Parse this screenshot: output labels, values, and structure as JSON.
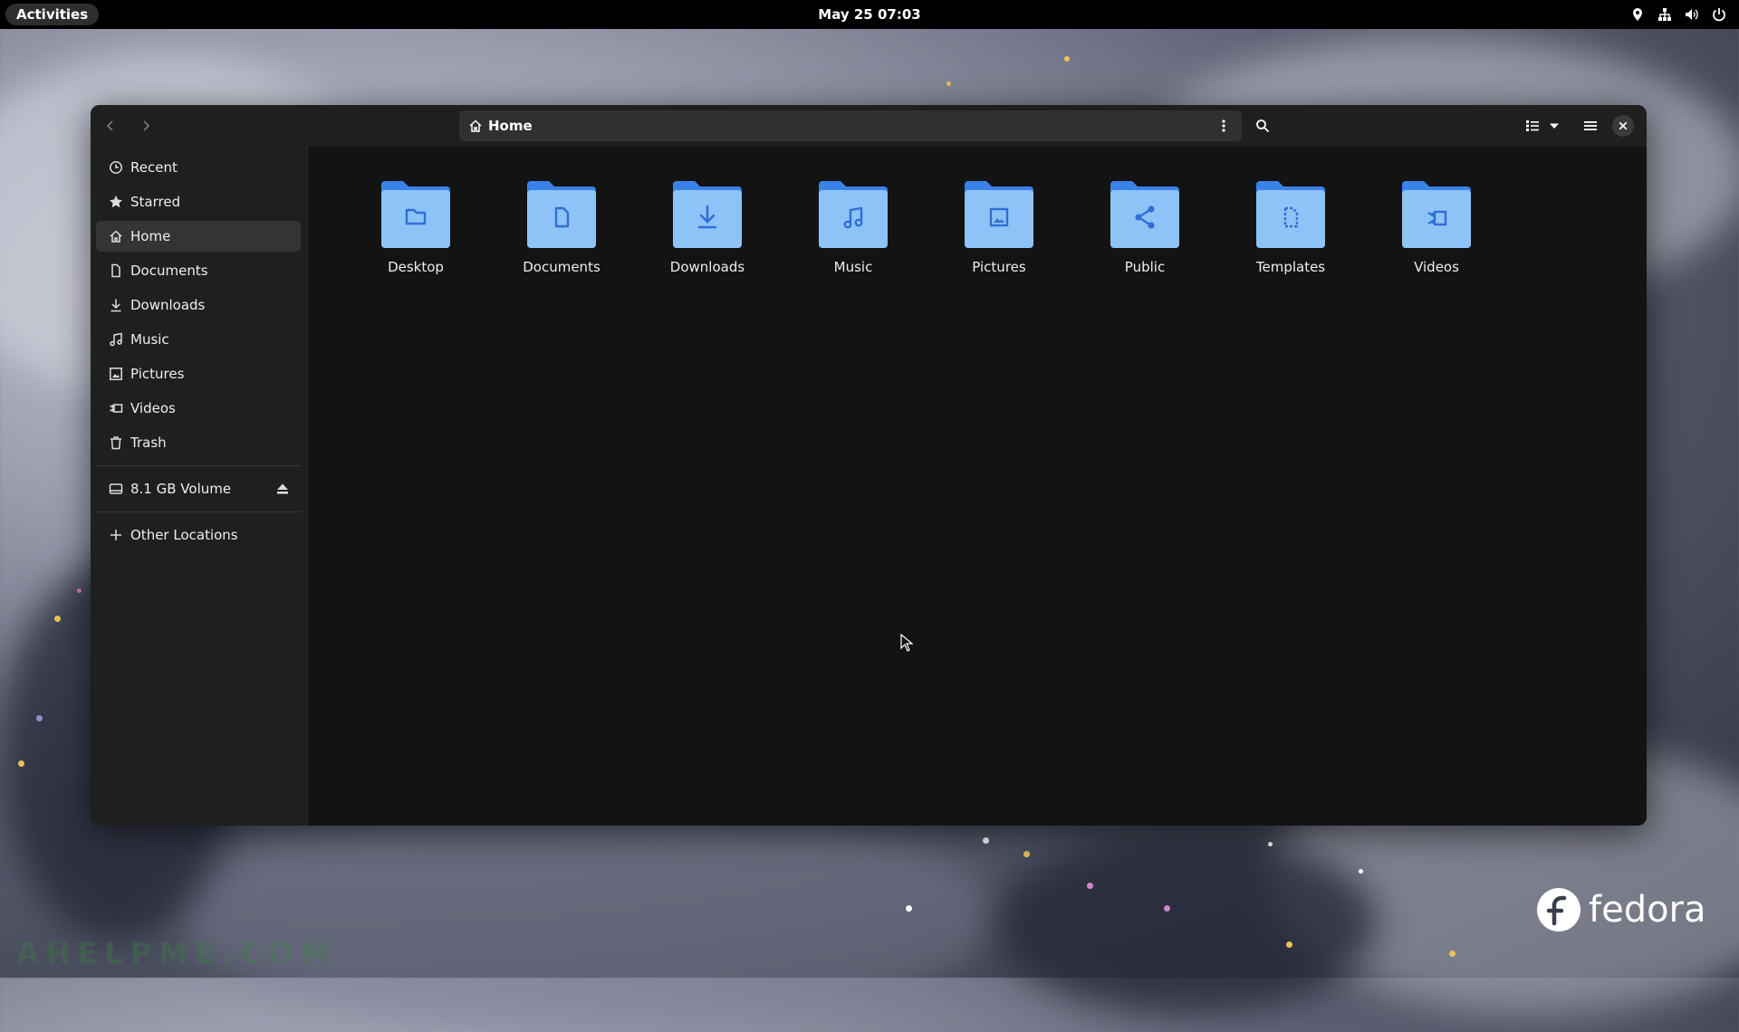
{
  "topbar": {
    "activities_label": "Activities",
    "clock": "May 25  07:03",
    "tray_icons": [
      "location-icon",
      "network-icon",
      "volume-icon",
      "power-icon"
    ]
  },
  "window": {
    "path_label": "Home",
    "nav_icons": [
      "back-icon",
      "forward-icon"
    ],
    "header_icons": [
      "path-menu-icon",
      "search-icon",
      "list-view-icon",
      "view-options-icon",
      "main-menu-icon",
      "close-icon"
    ]
  },
  "sidebar": {
    "items": [
      {
        "label": "Recent",
        "icon": "clock-icon"
      },
      {
        "label": "Starred",
        "icon": "star-icon"
      },
      {
        "label": "Home",
        "icon": "home-icon",
        "active": true
      },
      {
        "label": "Documents",
        "icon": "document-icon"
      },
      {
        "label": "Downloads",
        "icon": "download-icon"
      },
      {
        "label": "Music",
        "icon": "music-icon"
      },
      {
        "label": "Pictures",
        "icon": "picture-icon"
      },
      {
        "label": "Videos",
        "icon": "video-icon"
      },
      {
        "label": "Trash",
        "icon": "trash-icon"
      }
    ],
    "volume": {
      "label": "8.1 GB Volume",
      "icon": "drive-icon",
      "action_icon": "eject-icon"
    },
    "other": {
      "label": "Other Locations",
      "icon": "plus-icon"
    }
  },
  "folders": [
    {
      "label": "Desktop",
      "icon": "folder-desktop-icon"
    },
    {
      "label": "Documents",
      "icon": "folder-documents-icon"
    },
    {
      "label": "Downloads",
      "icon": "folder-downloads-icon"
    },
    {
      "label": "Music",
      "icon": "folder-music-icon"
    },
    {
      "label": "Pictures",
      "icon": "folder-pictures-icon"
    },
    {
      "label": "Public",
      "icon": "folder-public-icon"
    },
    {
      "label": "Templates",
      "icon": "folder-templates-icon"
    },
    {
      "label": "Videos",
      "icon": "folder-videos-icon"
    }
  ],
  "branding": {
    "logo_word": "fedora",
    "watermark": "AHELPME.COM"
  },
  "colors": {
    "folder_back": "#3b82e8",
    "folder_front": "#8ec3f7",
    "folder_glyph": "#2f6fd6",
    "window_bg": "#131313",
    "sidebar_bg": "#1f1f1f",
    "topbar_bg": "#000000"
  }
}
